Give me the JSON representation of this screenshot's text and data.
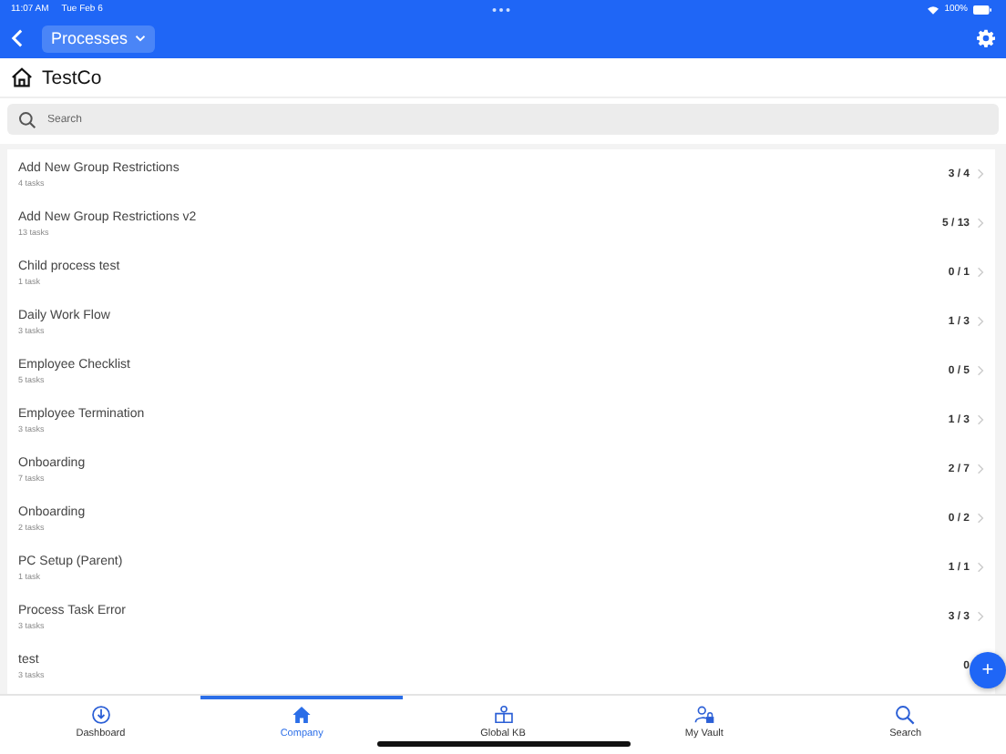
{
  "status_bar": {
    "time": "11:07 AM",
    "date": "Tue Feb 6",
    "battery_text": "100%"
  },
  "nav_bar": {
    "title": "Processes"
  },
  "header": {
    "title": "TestCo"
  },
  "search": {
    "placeholder": "Search"
  },
  "processes": [
    {
      "name": "Add New Group Restrictions",
      "tasks": "4 tasks",
      "count": "3 / 4"
    },
    {
      "name": "Add New Group Restrictions v2",
      "tasks": "13 tasks",
      "count": "5 / 13"
    },
    {
      "name": "Child process test",
      "tasks": "1 task",
      "count": "0 / 1"
    },
    {
      "name": "Daily Work Flow",
      "tasks": "3 tasks",
      "count": "1 / 3"
    },
    {
      "name": "Employee Checklist",
      "tasks": "5 tasks",
      "count": "0 / 5"
    },
    {
      "name": "Employee Termination",
      "tasks": "3 tasks",
      "count": "1 / 3"
    },
    {
      "name": "Onboarding",
      "tasks": "7 tasks",
      "count": "2 / 7"
    },
    {
      "name": "Onboarding",
      "tasks": "2 tasks",
      "count": "0 / 2"
    },
    {
      "name": "PC Setup (Parent)",
      "tasks": "1 task",
      "count": "1 / 1"
    },
    {
      "name": "Process Task Error",
      "tasks": "3 tasks",
      "count": "3 / 3"
    },
    {
      "name": "test",
      "tasks": "3 tasks",
      "count": "0"
    }
  ],
  "fab": {
    "label": "+"
  },
  "tab_bar": [
    {
      "kind": "dashboard",
      "label": "Dashboard",
      "selected": false
    },
    {
      "kind": "company",
      "label": "Company",
      "selected": true
    },
    {
      "kind": "kb",
      "label": "Global KB",
      "selected": false
    },
    {
      "kind": "vault",
      "label": "My Vault",
      "selected": false
    },
    {
      "kind": "search",
      "label": "Search",
      "selected": false
    }
  ]
}
